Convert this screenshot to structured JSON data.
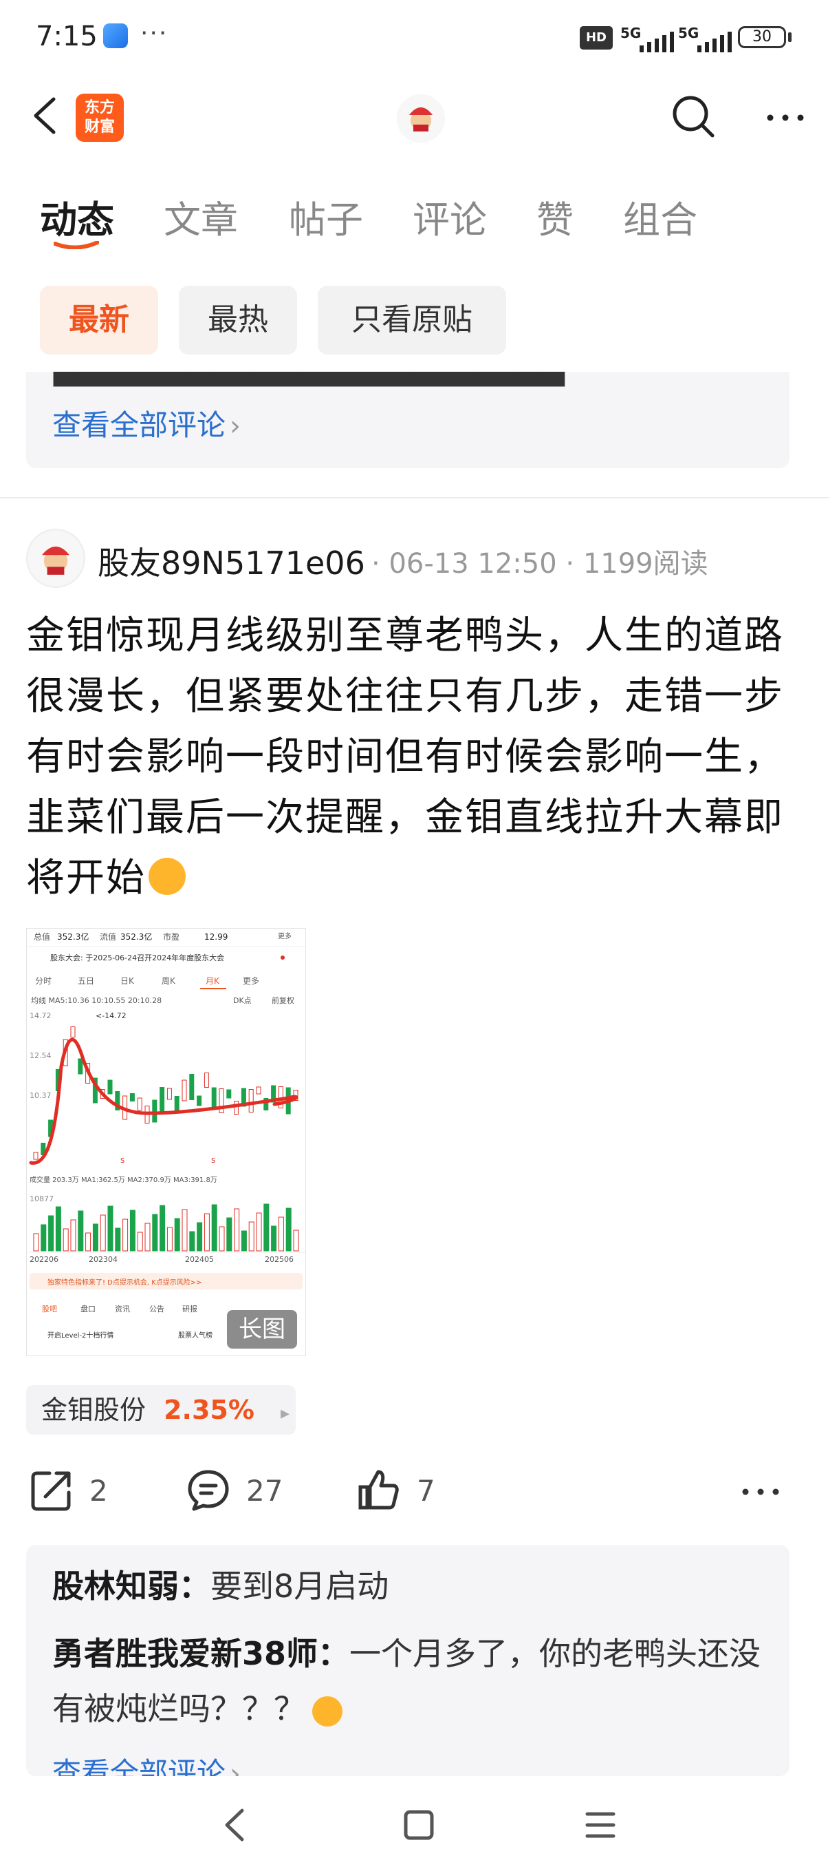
{
  "status_bar": {
    "time": "7:15",
    "more": "···",
    "hd_label": "HD",
    "signal1": "5G",
    "signal2": "5G",
    "battery": "30"
  },
  "header": {
    "logo_line1": "东方",
    "logo_line2": "财富"
  },
  "tabs": [
    {
      "label": "动态"
    },
    {
      "label": "文章"
    },
    {
      "label": "帖子"
    },
    {
      "label": "评论"
    },
    {
      "label": "赞"
    },
    {
      "label": "组合"
    }
  ],
  "filters": [
    {
      "label": "最新"
    },
    {
      "label": "最热"
    },
    {
      "label": "只看原贴"
    }
  ],
  "prev_comment": {
    "view_all": "查看全部评论"
  },
  "post": {
    "username": "股友89N5171e06",
    "date": "06-13 12:50",
    "reads": "1199阅读",
    "text": "金钼惊现月线级别至尊老鸭头，人生的道路很漫长，但紧要处往往只有几步，走错一步有时会影响一段时间但有时候会影响一生，韭菜们最后一次提醒，金钼直线拉升大幕即将开始",
    "long_image_badge": "长图",
    "stock_name": "金钼股份",
    "stock_change": "2.35%",
    "share_count": "2",
    "comment_count": "27",
    "like_count": "7"
  },
  "chart_image": {
    "top_row": [
      "总值",
      "352.3亿",
      "流值",
      "352.3亿",
      "市盈",
      "12.99",
      "更多"
    ],
    "notice": "股东大会: 于2025-06-24召开2024年年度股东大会",
    "periods": [
      "分时",
      "五日",
      "日K",
      "周K",
      "月K",
      "更多"
    ],
    "ma_line": "均线 MA5:10.36 10:10.55 20:10.28",
    "dk": "DK点",
    "adj": "前复权",
    "price_labels": [
      "14.72",
      "12.54",
      "10.37"
    ],
    "peak_label": "<-14.72",
    "vol_line": "成交量 203.3万 MA1:362.5万 MA2:370.9万 MA3:391.8万",
    "vol_label": "10877",
    "dates": [
      "202206",
      "202304",
      "202405",
      "202506"
    ],
    "banner": "独家特色指标来了! D点提示机会, K点提示风险>>",
    "bottom_tabs": [
      "股吧",
      "盘口",
      "资讯",
      "公告",
      "研报"
    ],
    "bottom_items": [
      "开启Level-2十档行情",
      "股票人气榜"
    ]
  },
  "comments": [
    {
      "name": "股林知弱",
      "text": "要到8月启动"
    },
    {
      "name": "勇者胜我爱新38师",
      "text": "一个月多了，你的老鸭头还没有被炖烂吗？？？"
    }
  ],
  "comments_view_all": "查看全部评论",
  "colors": {
    "accent": "#f0541e",
    "link": "#2a6fce",
    "up": "#e02e24",
    "down": "#1aa34a"
  }
}
